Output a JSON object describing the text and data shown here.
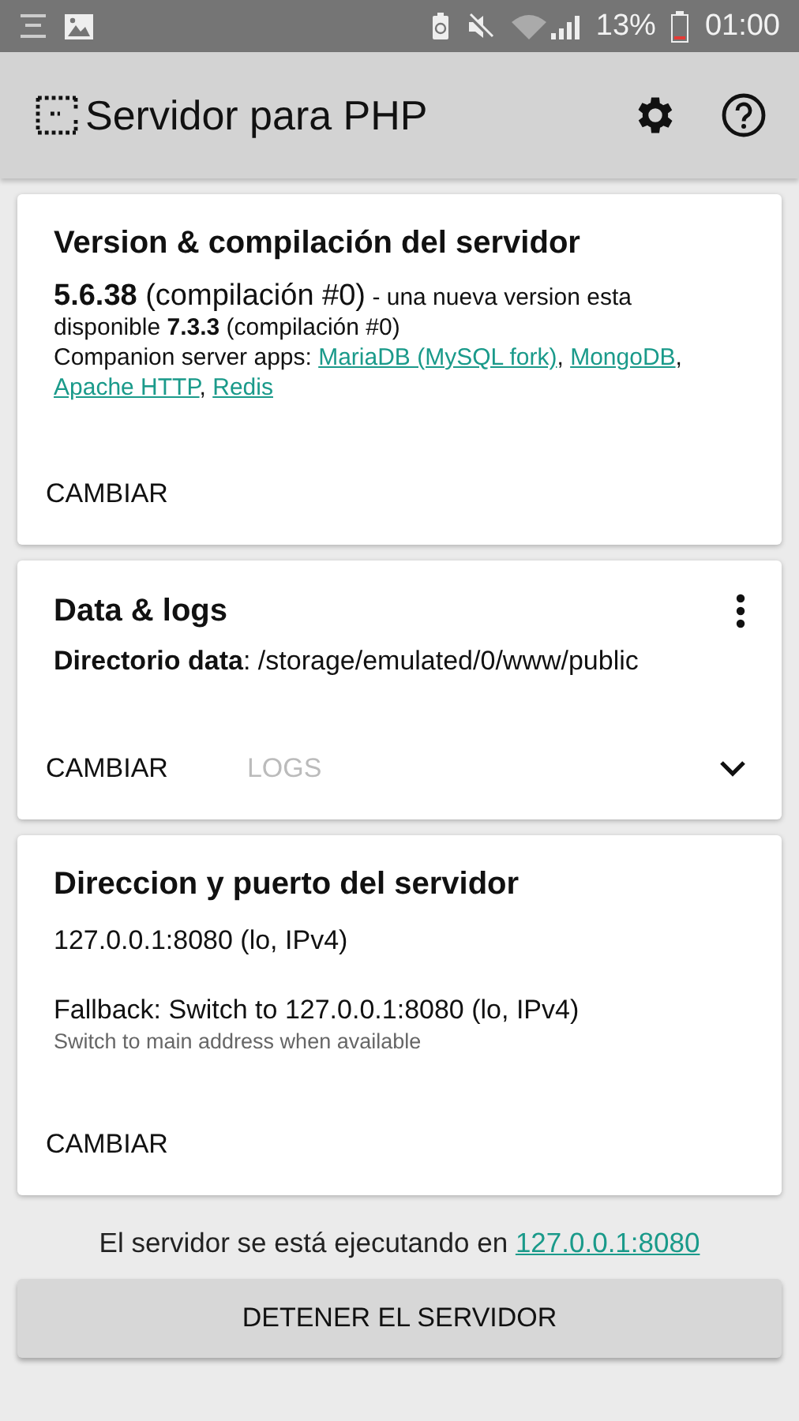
{
  "status_bar": {
    "battery_text": "13%",
    "time": "01:00"
  },
  "app_bar": {
    "title": "Servidor para PHP"
  },
  "version_card": {
    "title": "Version & compilación del servidor",
    "current": "5.6.38",
    "current_build": "(compilación #0)",
    "notice": "- una nueva version esta disponible",
    "latest": "7.3.3",
    "latest_build": "(compilación #0)",
    "companions_label": "Companion server apps:",
    "companions": [
      "MariaDB (MySQL fork)",
      "MongoDB",
      "Apache HTTP",
      "Redis"
    ],
    "separator": ",",
    "actions": [
      {
        "label": "CAMBIAR",
        "disabled": false
      }
    ]
  },
  "data_card": {
    "title": "Data & logs",
    "directory": "**Directorio data**: /storage/emulated/0/www/public",
    "expanded": false,
    "actions": [
      {
        "label": "CAMBIAR",
        "disabled": false
      },
      {
        "label": "LOGS",
        "disabled": true
      }
    ]
  },
  "address_card": {
    "title": "Direccion y puerto del servidor",
    "address": "127.0.0.1:8080 (lo, IPv4)",
    "fallback": "Fallback: Switch to 127.0.0.1:8080 (lo, IPv4)",
    "fallback_hint": "Switch to main address when available",
    "actions": [
      {
        "label": "CAMBIAR",
        "disabled": false
      }
    ]
  },
  "footer": {
    "status": "El servidor se está ejecutando en",
    "link": "127.0.0.1:8080",
    "button": "DETENER EL SERVIDOR"
  }
}
